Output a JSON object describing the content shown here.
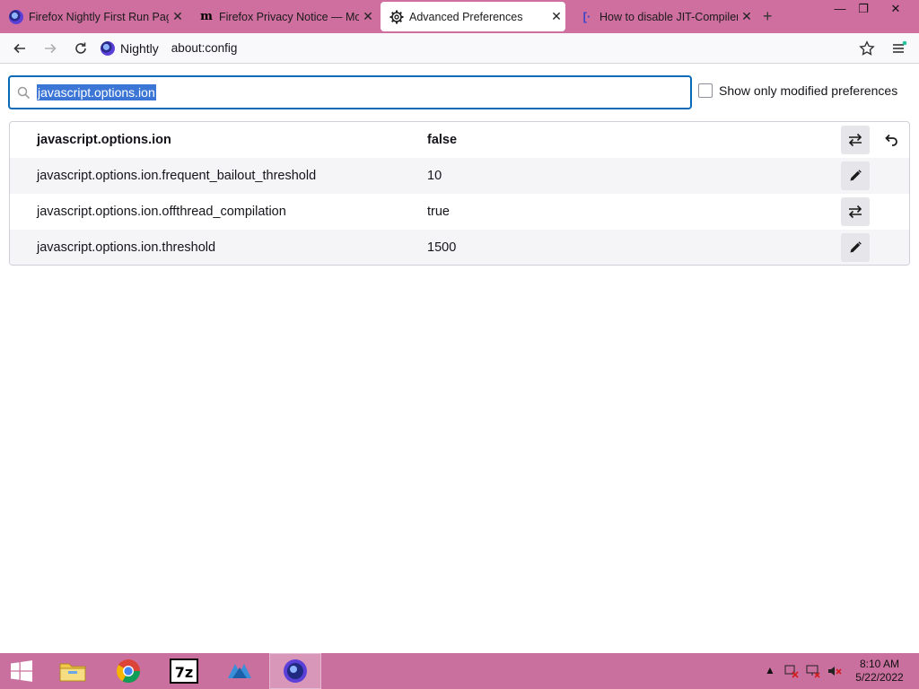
{
  "tabs": [
    {
      "title": "Firefox Nightly First Run Page",
      "icon": "nightly-icon",
      "active": false
    },
    {
      "title": "Firefox Privacy Notice — Mozilla",
      "icon": "mozilla-m-icon",
      "active": false
    },
    {
      "title": "Advanced Preferences",
      "icon": "gear-icon",
      "active": true
    },
    {
      "title": "How to disable JIT-Compiler",
      "icon": "bracket-icon",
      "active": false
    }
  ],
  "navbar": {
    "identity_label": "Nightly",
    "url": "about:config"
  },
  "search": {
    "query": "javascript.options.ion"
  },
  "modified_label": "Show only modified preferences",
  "prefs": [
    {
      "name": "javascript.options.ion",
      "value": "false",
      "type": "boolean",
      "modified": true
    },
    {
      "name": "javascript.options.ion.frequent_bailout_threshold",
      "value": "10",
      "type": "number",
      "modified": false
    },
    {
      "name": "javascript.options.ion.offthread_compilation",
      "value": "true",
      "type": "boolean",
      "modified": false
    },
    {
      "name": "javascript.options.ion.threshold",
      "value": "1500",
      "type": "number",
      "modified": false
    }
  ],
  "taskbar": {
    "apps": [
      "windows-start-icon",
      "file-explorer-icon",
      "chrome-icon",
      "7zip-icon",
      "app-icon",
      "firefox-nightly-icon"
    ],
    "time": "8:10 AM",
    "date": "5/22/2022"
  },
  "colors": {
    "accent": "#0b6ab8",
    "tabstrip": "#cf6f9f",
    "taskbar": "#c9709f",
    "selection": "#3b76d6"
  }
}
